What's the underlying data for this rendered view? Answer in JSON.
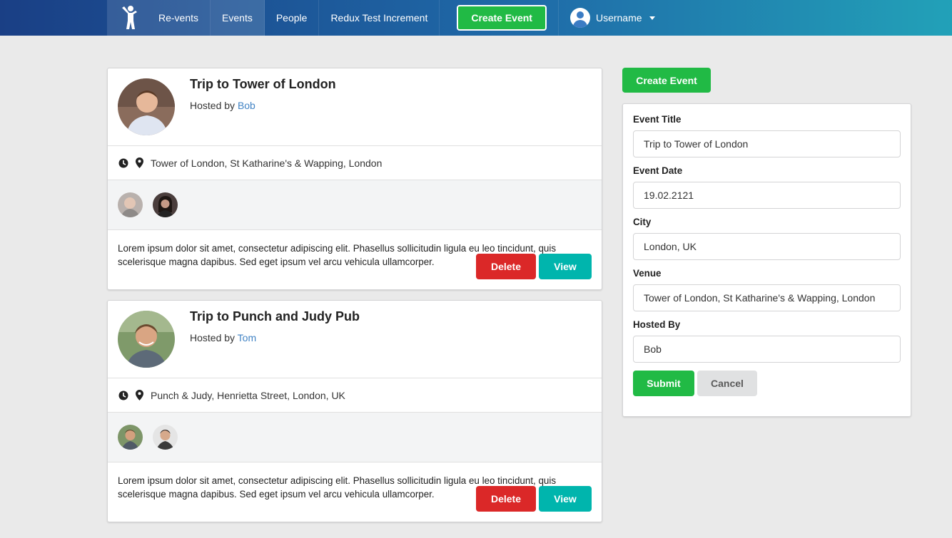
{
  "nav": {
    "brand": "Re-vents",
    "events": "Events",
    "people": "People",
    "redux_test": "Redux Test Increment",
    "create_event": "Create Event",
    "username": "Username"
  },
  "events": [
    {
      "title": "Trip to Tower of London",
      "hosted_by_prefix": "Hosted by ",
      "host": "Bob",
      "venue": "Tower of London, St Katharine's & Wapping, London",
      "description": "Lorem ipsum dolor sit amet, consectetur adipiscing elit. Phasellus sollicitudin ligula eu leo tincidunt, quis scelerisque magna dapibus. Sed eget ipsum vel arcu vehicula ullamcorper.",
      "delete_label": "Delete",
      "view_label": "View"
    },
    {
      "title": "Trip to Punch and Judy Pub",
      "hosted_by_prefix": "Hosted by ",
      "host": "Tom",
      "venue": "Punch & Judy, Henrietta Street, London, UK",
      "description": "Lorem ipsum dolor sit amet, consectetur adipiscing elit. Phasellus sollicitudin ligula eu leo tincidunt, quis scelerisque magna dapibus. Sed eget ipsum vel arcu vehicula ullamcorper.",
      "delete_label": "Delete",
      "view_label": "View"
    }
  ],
  "form": {
    "toggle_button": "Create Event",
    "fields": {
      "title": {
        "label": "Event Title",
        "value": "Trip to Tower of London"
      },
      "date": {
        "label": "Event Date",
        "value": "19.02.2121"
      },
      "city": {
        "label": "City",
        "value": "London, UK"
      },
      "venue": {
        "label": "Venue",
        "value": "Tower of London, St Katharine's & Wapping, London"
      },
      "hosted_by": {
        "label": "Hosted By",
        "value": "Bob"
      }
    },
    "submit_label": "Submit",
    "cancel_label": "Cancel"
  },
  "colors": {
    "nav_gradient_start": "#1a3f85",
    "nav_gradient_end": "#22a1b8",
    "green": "#21ba45",
    "red": "#db2828",
    "teal": "#00b5ad",
    "link": "#4183c4"
  }
}
